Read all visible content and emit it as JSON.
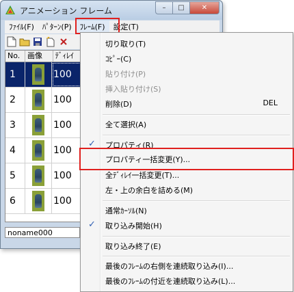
{
  "window": {
    "title": "アニメーション フレーム",
    "minimize_glyph": "–",
    "maximize_glyph": "□",
    "close_glyph": "✕"
  },
  "menubar": {
    "file": "ﾌｧｲﾙ(F)",
    "pattern": "ﾊﾟﾀｰﾝ(P)",
    "frame": "ﾌﾚｰﾑ(F)",
    "settings": "設定(T)"
  },
  "grid": {
    "headers": {
      "no": "No.",
      "image": "画像",
      "delay": "ﾃﾞｨﾚｲ"
    },
    "rows": [
      {
        "no": "1",
        "delay": "100",
        "selected": true
      },
      {
        "no": "2",
        "delay": "100"
      },
      {
        "no": "3",
        "delay": "100"
      },
      {
        "no": "4",
        "delay": "100"
      },
      {
        "no": "5",
        "delay": "100"
      },
      {
        "no": "6",
        "delay": "100"
      }
    ]
  },
  "status": {
    "filename": "noname000"
  },
  "frame_menu": {
    "cut": "切り取り(T)",
    "copy": "ｺﾋﾟｰ(C)",
    "paste": "貼り付け(P)",
    "insert_paste": "挿入貼り付け(S)",
    "delete": "削除(D)",
    "delete_shortcut": "DEL",
    "select_all": "全て選択(A)",
    "properties": "プロパティ(R)",
    "bulk_properties": "プロパティ一括変更(Y)...",
    "bulk_delay": "全ﾃﾞｨﾚｲ一括変更(T)...",
    "trim_margins": "左・上の余白を詰める(M)",
    "normal_cursor": "通常ｶｰｿﾙ(N)",
    "capture_start": "取り込み開始(H)",
    "capture_end": "取り込み終了(E)",
    "capture_right": "最後のﾌﾚｰﾑの右側を連続取り込み(I)...",
    "capture_near": "最後のﾌﾚｰﾑの付近を連続取り込み(L)..."
  },
  "colors": {
    "highlight_box": "#e0201e",
    "selection": "#0a246a",
    "check": "#2f5fb3"
  }
}
